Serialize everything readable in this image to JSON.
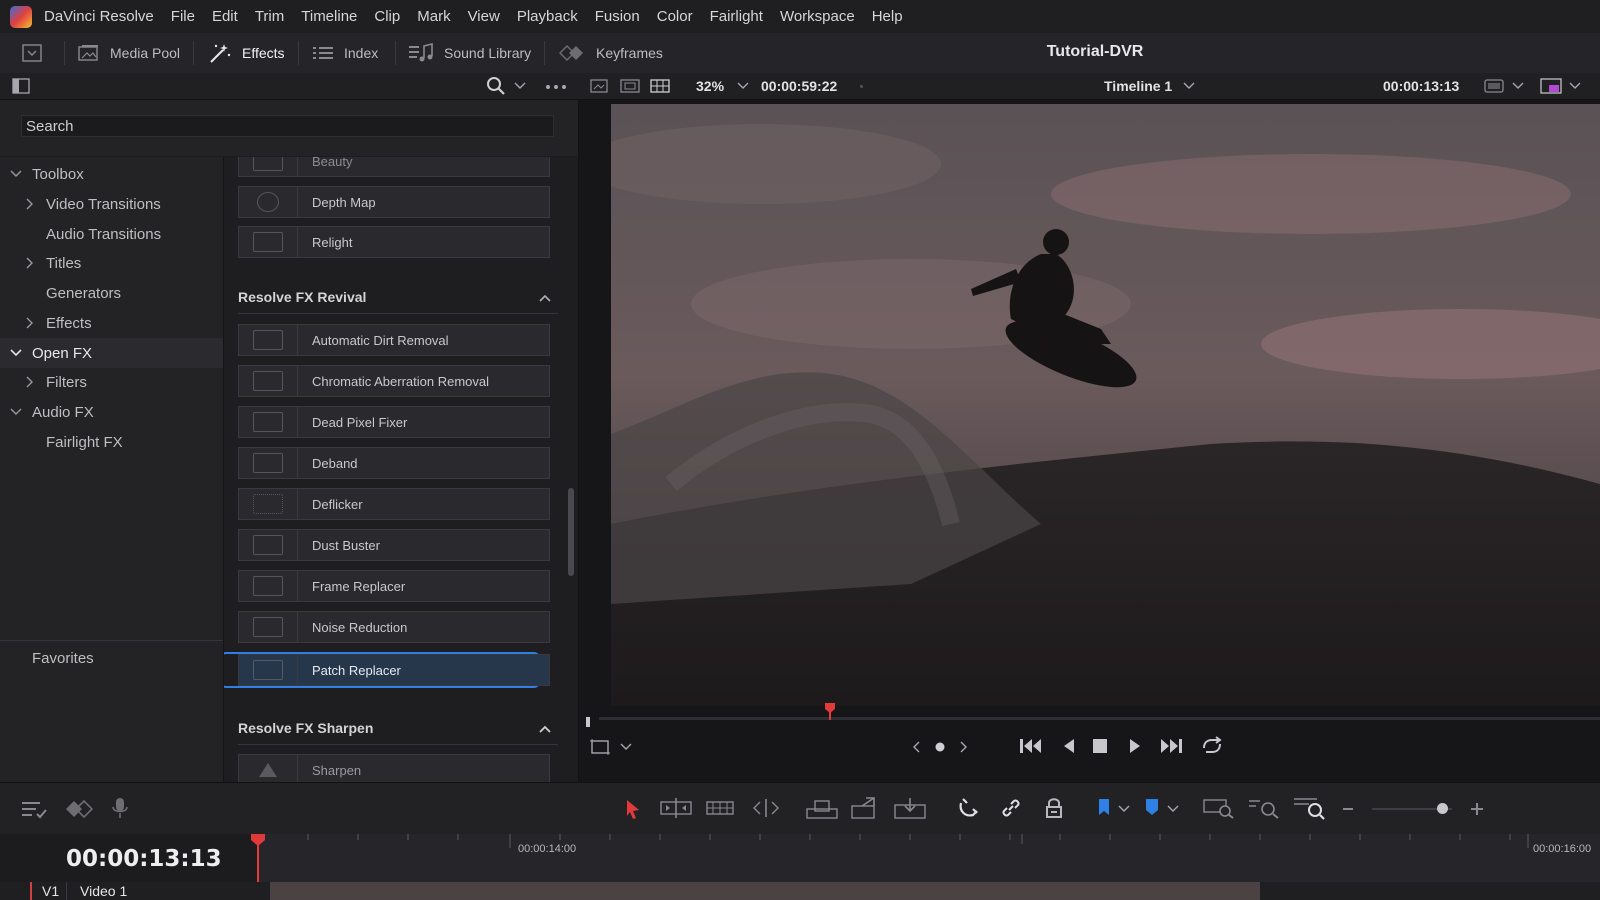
{
  "menubar": {
    "app_name": "DaVinci Resolve",
    "items": [
      "File",
      "Edit",
      "Trim",
      "Timeline",
      "Clip",
      "Mark",
      "View",
      "Playback",
      "Fusion",
      "Color",
      "Fairlight",
      "Workspace",
      "Help"
    ]
  },
  "toolbar": {
    "media_pool": "Media Pool",
    "effects": "Effects",
    "index": "Index",
    "sound_library": "Sound Library",
    "keyframes": "Keyframes",
    "project_title": "Tutorial-DVR"
  },
  "viewer_bar": {
    "zoom": "32%",
    "duration": "00:00:59:22",
    "timeline_name": "Timeline 1",
    "timecode": "00:00:13:13"
  },
  "search": {
    "placeholder": "Search"
  },
  "tree": {
    "items": [
      {
        "label": "Toolbox"
      },
      {
        "label": "Video Transitions"
      },
      {
        "label": "Audio Transitions"
      },
      {
        "label": "Titles"
      },
      {
        "label": "Generators"
      },
      {
        "label": "Effects"
      },
      {
        "label": "Open FX"
      },
      {
        "label": "Filters"
      },
      {
        "label": "Audio FX"
      },
      {
        "label": "Fairlight FX"
      }
    ],
    "favorites": "Favorites"
  },
  "fx": {
    "top_items": [
      "Beauty",
      "Depth Map",
      "Relight"
    ],
    "revival_header": "Resolve FX Revival",
    "revival_items": [
      "Automatic Dirt Removal",
      "Chromatic Aberration Removal",
      "Dead Pixel Fixer",
      "Deband",
      "Deflicker",
      "Dust Buster",
      "Frame Replacer",
      "Noise Reduction",
      "Patch Replacer"
    ],
    "sharpen_header": "Resolve FX Sharpen",
    "sharpen_items": [
      "Sharpen"
    ]
  },
  "timeline": {
    "timecode": "00:00:13:13",
    "ruler_labels": [
      "00:00:14:00",
      "00:00:16:00"
    ],
    "track_id": "V1",
    "track_name": "Video 1"
  },
  "colors": {
    "accent_blue": "#2e7fe6",
    "playhead_red": "#e03a3a",
    "panel_bg": "#232326"
  }
}
